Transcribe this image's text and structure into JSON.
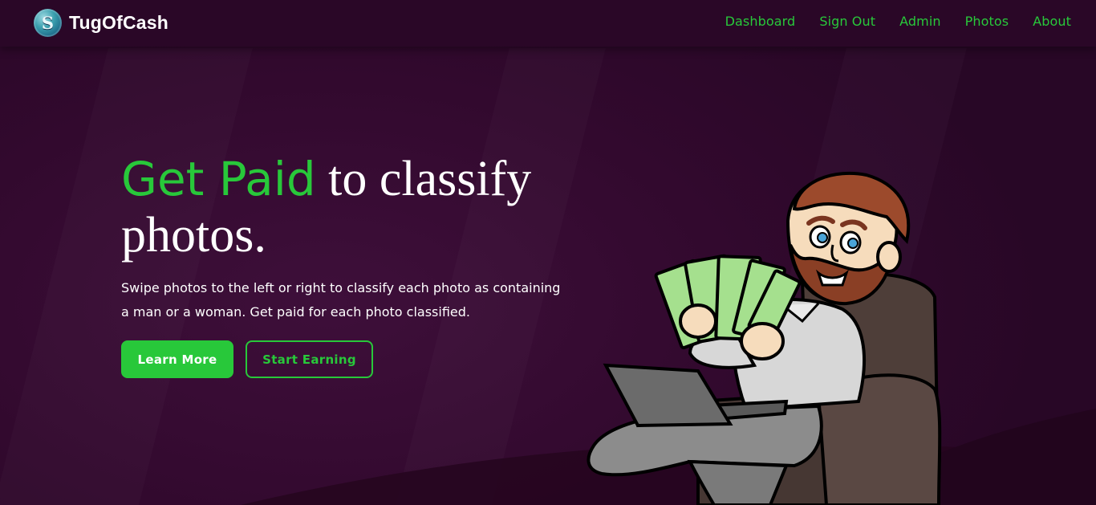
{
  "brand": {
    "logo_letter": "S",
    "name": "TugOfCash"
  },
  "nav": {
    "items": [
      {
        "label": "Dashboard"
      },
      {
        "label": "Sign Out"
      },
      {
        "label": "Admin"
      },
      {
        "label": "Photos"
      },
      {
        "label": "About"
      }
    ]
  },
  "hero": {
    "headline_accent": "Get Paid",
    "headline_rest": " to classify photos.",
    "subtext": "Swipe photos to the left or right to classify each photo as containing a man or a woman. Get paid for each photo classified.",
    "primary_button": "Learn More",
    "secondary_button": "Start Earning"
  },
  "colors": {
    "accent": "#28c83a",
    "background": "#2e0a2c",
    "navbar": "#2a0727",
    "text": "#ffffff"
  },
  "icons": {
    "logo": "dollar-s-logo-icon",
    "illustration": "man-on-armchair-holding-cash-with-laptop"
  }
}
